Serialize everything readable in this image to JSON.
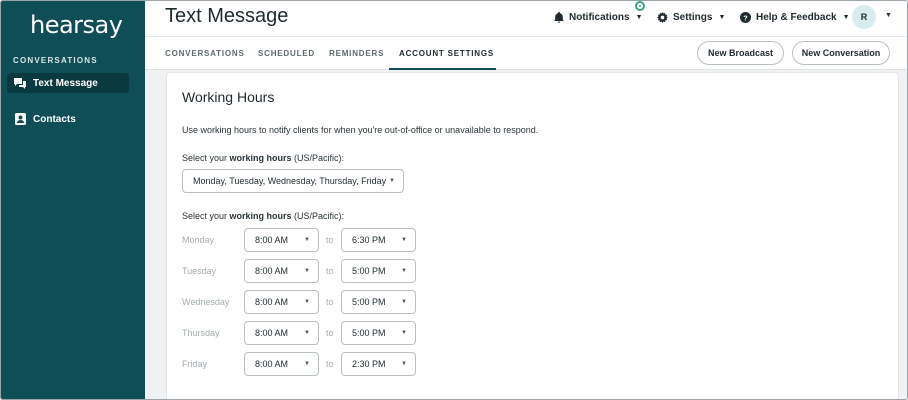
{
  "sidebar": {
    "logo": "hearsay",
    "section_label": "CONVERSATIONS",
    "items": [
      {
        "label": "Text Message",
        "icon": "chat-icon",
        "active": true
      },
      {
        "label": "Contacts",
        "icon": "contact-card-icon",
        "active": false
      }
    ]
  },
  "header": {
    "title": "Text Message",
    "notifications": "Notifications",
    "settings": "Settings",
    "help": "Help & Feedback",
    "avatar_initial": "R"
  },
  "tabs": [
    {
      "label": "CONVERSATIONS"
    },
    {
      "label": "SCHEDULED"
    },
    {
      "label": "REMINDERS"
    },
    {
      "label": "ACCOUNT SETTINGS",
      "active": true
    }
  ],
  "actions": {
    "new_broadcast": "New Broadcast",
    "new_conversation": "New Conversation"
  },
  "working_hours": {
    "title": "Working Hours",
    "description": "Use working hours to notify clients for when you're out-of-office or unavailable to respond.",
    "label_prefix": "Select your ",
    "label_bold": "working hours",
    "label_suffix": " (US/Pacific):",
    "days_selected": "Monday, Tuesday, Wednesday, Thursday, Friday",
    "to_label": "to",
    "schedule": [
      {
        "day": "Monday",
        "start": "8:00 AM",
        "end": "6:30 PM"
      },
      {
        "day": "Tuesday",
        "start": "8:00 AM",
        "end": "5:00 PM"
      },
      {
        "day": "Wednesday",
        "start": "8:00 AM",
        "end": "5:00 PM"
      },
      {
        "day": "Thursday",
        "start": "8:00 AM",
        "end": "5:00 PM"
      },
      {
        "day": "Friday",
        "start": "8:00 AM",
        "end": "2:30 PM"
      }
    ]
  },
  "colors": {
    "sidebar": "#0f4d57",
    "accent": "#0f4d57",
    "notification_dot": "#3aa487"
  }
}
